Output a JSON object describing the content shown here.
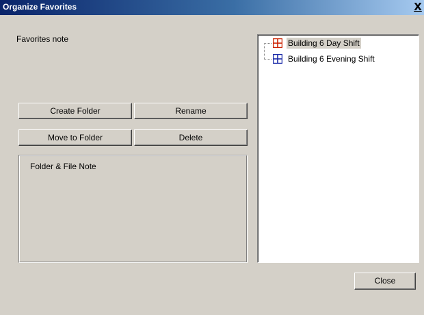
{
  "window": {
    "title": "Organize Favorites",
    "close_glyph": "X"
  },
  "favorites_note": "Favorites note",
  "buttons": {
    "create_folder": "Create Folder",
    "rename": "Rename",
    "move_to_folder": "Move to Folder",
    "delete": "Delete",
    "close": "Close"
  },
  "group": {
    "label": "Folder & File Note"
  },
  "tree": {
    "items": [
      {
        "label": "Building 6 Day Shift",
        "icon": "grid-red-icon",
        "color": "#cc2200",
        "selected": true
      },
      {
        "label": "Building 6 Evening Shift",
        "icon": "grid-blue-icon",
        "color": "#1a2aa8",
        "selected": false
      }
    ]
  },
  "colors": {
    "titlebar_start": "#0a246a",
    "titlebar_end": "#a6caf0",
    "dialog_bg": "#d4d0c8"
  }
}
